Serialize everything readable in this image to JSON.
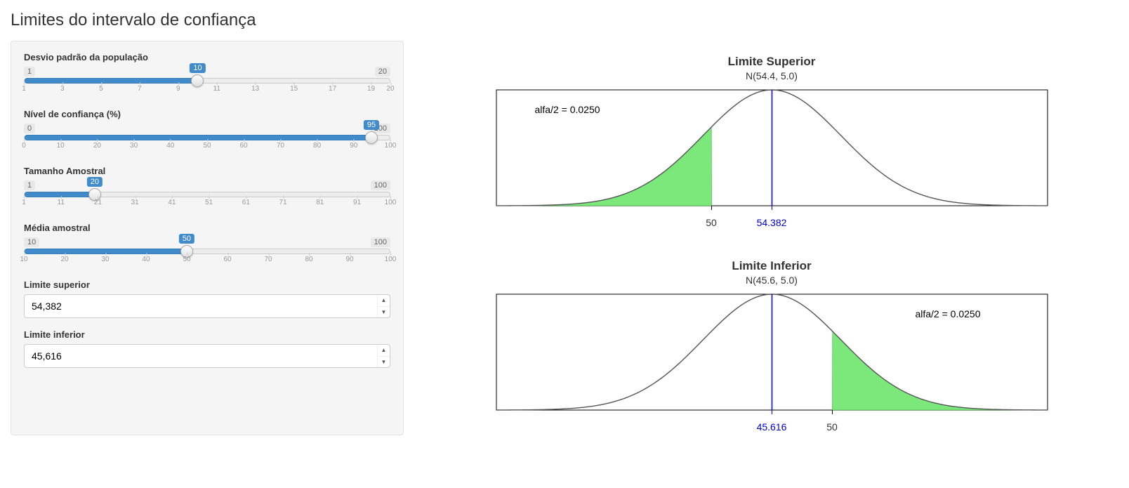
{
  "page_title": "Limites do intervalo de confiança",
  "sliders": {
    "sigma": {
      "label": "Desvio padrão da população",
      "min": "1",
      "max": "20",
      "value": "10",
      "ticks": [
        "1",
        "3",
        "5",
        "7",
        "9",
        "11",
        "13",
        "15",
        "17",
        "19",
        "20"
      ],
      "pct": 47.4
    },
    "conf": {
      "label": "Nível de confiança (%)",
      "min": "0",
      "max": "100",
      "value": "95",
      "ticks": [
        "0",
        "10",
        "20",
        "30",
        "40",
        "50",
        "60",
        "70",
        "80",
        "90",
        "100"
      ],
      "pct": 95.0
    },
    "n": {
      "label": "Tamanho Amostral",
      "min": "1",
      "max": "100",
      "value": "20",
      "ticks": [
        "1",
        "11",
        "21",
        "31",
        "41",
        "51",
        "61",
        "71",
        "81",
        "91",
        "100"
      ],
      "pct": 19.2
    },
    "xbar": {
      "label": "Média amostral",
      "min": "10",
      "max": "100",
      "value": "50",
      "ticks": [
        "10",
        "20",
        "30",
        "40",
        "50",
        "60",
        "70",
        "80",
        "90",
        "100"
      ],
      "pct": 44.4
    }
  },
  "numeric": {
    "upper": {
      "label": "Limite superior",
      "value": "54,382"
    },
    "lower": {
      "label": "Limite inferior",
      "value": "45,616"
    }
  },
  "plots": {
    "upper": {
      "title": "Limite Superior",
      "subtitle": "N(54.4, 5.0)",
      "annotation": "alfa/2 =  0.0250",
      "x_center_label": "50",
      "x_mean_label": "54.382",
      "annot_side": "left",
      "tail_side": "left"
    },
    "lower": {
      "title": "Limite Inferior",
      "subtitle": "N(45.6, 5.0)",
      "annotation": "alfa/2 =  0.0250",
      "x_center_label": "50",
      "x_mean_label": "45.616",
      "annot_side": "right",
      "tail_side": "right"
    }
  },
  "chart_data": {
    "type": "area",
    "description": "Two normal-density plots showing the upper and lower CI limits for a sample mean of 50, σ=10, n=20, 95% confidence (SE=5.0). Shaded tails each have area α/2 = 0.0250.",
    "series": [
      {
        "name": "Limite Superior",
        "distribution": "N(54.4, 5.0)",
        "mean": 54.382,
        "se": 5.0,
        "vline_at": 50,
        "shaded_tail": "left",
        "shaded_area": 0.025
      },
      {
        "name": "Limite Inferior",
        "distribution": "N(45.6, 5.0)",
        "mean": 45.616,
        "se": 5.0,
        "vline_at": 50,
        "shaded_tail": "right",
        "shaded_area": 0.025
      }
    ],
    "x_reference": 50
  }
}
